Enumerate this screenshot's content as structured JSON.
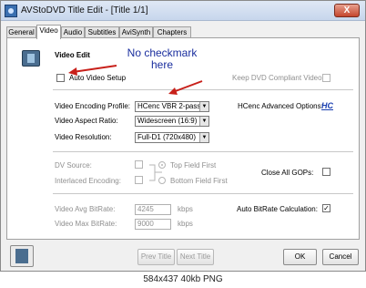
{
  "window": {
    "title": "AVStoDVD Title Edit - [Title 1/1]",
    "close_label": "X"
  },
  "tabs": [
    {
      "label": "General"
    },
    {
      "label": "Video"
    },
    {
      "label": "Audio"
    },
    {
      "label": "Subtitles"
    },
    {
      "label": "AviSynth"
    },
    {
      "label": "Chapters"
    }
  ],
  "video_edit": {
    "heading": "Video Edit",
    "auto_setup": {
      "label": "Auto Video Setup",
      "checked": false
    },
    "keep_dvd": {
      "label": "Keep DVD Compliant Video:",
      "checked": false
    },
    "encoding_profile": {
      "label": "Video Encoding Profile:",
      "value": "HCenc VBR 2-pass"
    },
    "hcenc_advanced": {
      "label": "HCenc Advanced Options:",
      "icon_text": "HC"
    },
    "aspect_ratio": {
      "label": "Video Aspect Ratio:",
      "value": "Widescreen (16:9)"
    },
    "resolution": {
      "label": "Video Resolution:",
      "value": "Full-D1 (720x480)"
    },
    "dv_source": {
      "label": "DV Source:"
    },
    "interlaced": {
      "label": "Interlaced Encoding:"
    },
    "top_field": {
      "label": "Top Field First"
    },
    "bottom_field": {
      "label": "Bottom Field First"
    },
    "close_gops": {
      "label": "Close All GOPs:",
      "checked": false
    },
    "avg_bitrate": {
      "label": "Video Avg BitRate:",
      "value": "4245",
      "unit": "kbps"
    },
    "max_bitrate": {
      "label": "Video Max BitRate:",
      "value": "9000",
      "unit": "kbps"
    },
    "auto_bitrate": {
      "label": "Auto BitRate Calculation:",
      "checked": true,
      "mark": "✓"
    }
  },
  "annotation": {
    "line1": "No checkmark",
    "line2": "here"
  },
  "buttons": {
    "prev": "Prev Title",
    "next": "Next Title",
    "ok": "OK",
    "cancel": "Cancel"
  },
  "caption": "584x437 40kb PNG",
  "colors": {
    "annotation_arrow": "#c8201a",
    "annotation_text": "#1a2e9e"
  }
}
